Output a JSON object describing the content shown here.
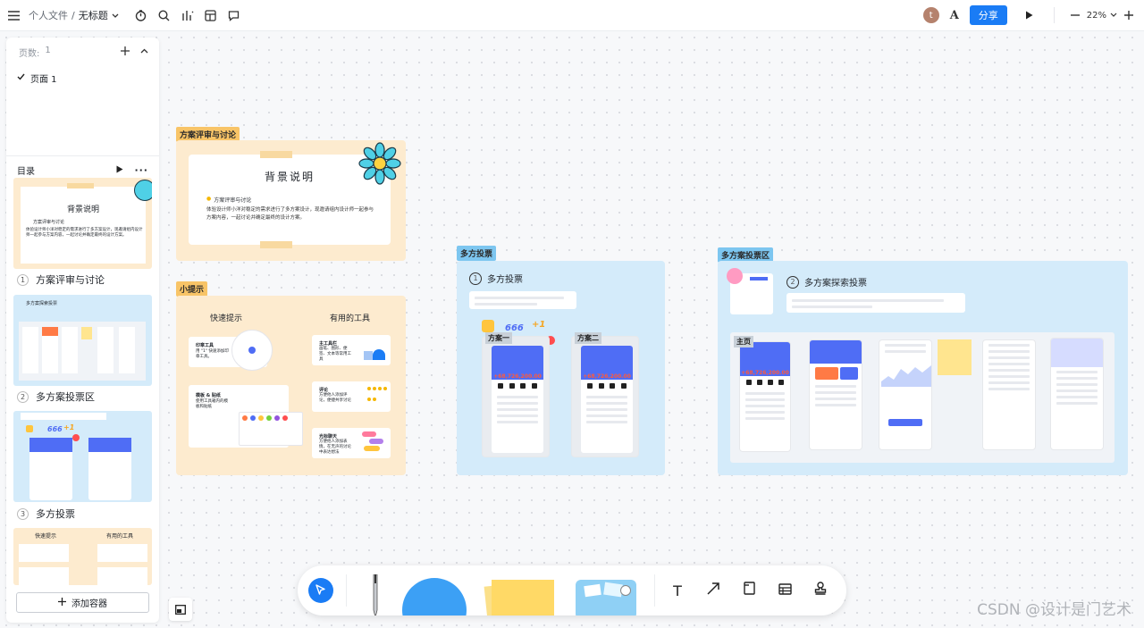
{
  "topbar": {
    "breadcrumb_parent": "个人文件",
    "separator": "/",
    "doc_title": "无标题",
    "avatar_letter": "t",
    "share_label": "分享",
    "zoom_level": "22%"
  },
  "sidebar": {
    "pages_label": "页数:",
    "pages_count": "1",
    "page_item": "页面 1",
    "toc_label": "目录",
    "items": [
      {
        "num": "1",
        "label": "方案评审与讨论"
      },
      {
        "num": "2",
        "label": "多方案投票区"
      },
      {
        "num": "3",
        "label": "多方投票"
      }
    ],
    "thumb1_title": "背景说明",
    "thumb1_sub": "方案评审与讨论",
    "thumb1_desc": "体验设计师小洋对稳定的需求进行了多方案设计，现邀请组内设计师一起参与方案内容，一起讨论并确定最终的设计方案。",
    "thumb2_title": "多方案探索投票",
    "thumb3_num": "666",
    "thumb3_plus": "+1",
    "thumb4_left": "快速提示",
    "thumb4_right": "有用的工具",
    "add_container": "添加容器"
  },
  "canvas": {
    "frame1": {
      "tag": "方案评审与讨论",
      "title": "背景说明",
      "subtitle": "方案评审与讨论",
      "desc": "体验设计师小洋对稳定的需求进行了多方案设计，现邀请组内设计师一起参与方案内容，一起讨论并确定最终的设计方案。"
    },
    "frame2": {
      "tag": "小提示",
      "left_title": "快速提示",
      "right_title": "有用的工具",
      "tip1_title": "印章工具",
      "tip1_desc": "用 \"1\" 快速添加印章工具。",
      "tip2_title": "模板 & 贴纸",
      "tip2_desc": "使用工具箱内的模板和贴纸",
      "tool1_title": "主工具栏",
      "tool1_desc": "画笔、图形、便签、文本等常用工具",
      "tool2_title": "评论",
      "tool2_desc": "方便他人添加评论，便捷共享讨论",
      "tool3_title": "光标聊天",
      "tool3_desc": "方便他人添加表情，在无声的讨论中表达想法"
    },
    "frame3": {
      "tag": "多方投票",
      "title": "多方投票",
      "num": "1",
      "label_a": "方案一",
      "label_b": "方案二",
      "vote_count": "666",
      "vote_plus": "+1",
      "amount": "+68,726,200.00"
    },
    "frame4": {
      "tag": "多方案投票区",
      "title": "多方案探索投票",
      "num": "2",
      "home_label": "主页",
      "amount": "+68,726,200.00"
    }
  },
  "toolbar": {
    "select": "select-tool",
    "text": "T"
  },
  "watermark": "CSDN @设计是门艺术",
  "colors": {
    "accent": "#1a7cf5",
    "orange_frame": "#fdebcf",
    "blue_frame": "#d4ebfa",
    "tag_orange": "#f8c467",
    "tag_blue": "#7dc6f0"
  }
}
